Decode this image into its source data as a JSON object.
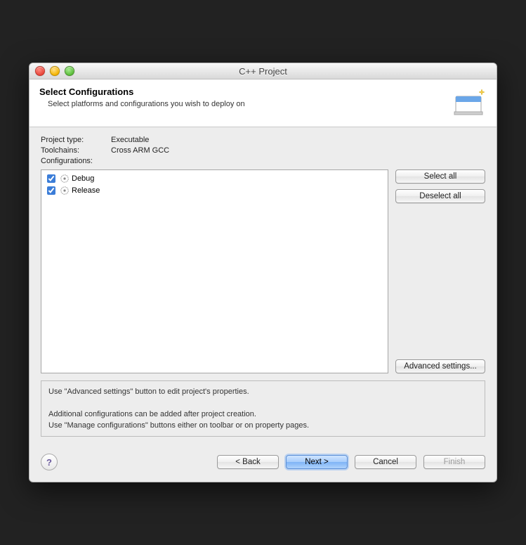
{
  "window": {
    "title": "C++ Project"
  },
  "header": {
    "title": "Select Configurations",
    "subtitle": "Select platforms and configurations you wish to deploy on"
  },
  "info": {
    "project_type_label": "Project type:",
    "project_type_value": "Executable",
    "toolchains_label": "Toolchains:",
    "toolchains_value": "Cross ARM GCC",
    "configurations_label": "Configurations:"
  },
  "configurations": [
    {
      "name": "Debug",
      "checked": true
    },
    {
      "name": "Release",
      "checked": true
    }
  ],
  "side": {
    "select_all": "Select all",
    "deselect_all": "Deselect all",
    "advanced": "Advanced settings..."
  },
  "hint": {
    "line1": "Use \"Advanced settings\" button to edit project's properties.",
    "line2": "Additional configurations can be added after project creation.",
    "line3": "Use \"Manage configurations\" buttons either on toolbar or on property pages."
  },
  "footer": {
    "back": "< Back",
    "next": "Next >",
    "cancel": "Cancel",
    "finish": "Finish"
  }
}
